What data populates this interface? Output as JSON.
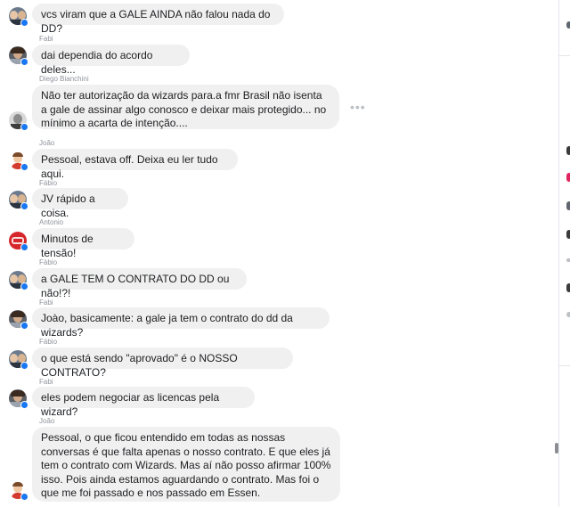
{
  "messages": [
    {
      "sender": "",
      "text": "vcs viram que a GALE AINDA não falou nada do DD?",
      "avatar": "group-avatar"
    },
    {
      "sender": "Fabi",
      "text": "dai dependia do acordo deles...",
      "avatar": "fabi-avatar"
    },
    {
      "sender": "Diego Bianchini",
      "text": "Não ter autorização da wizards para.a fmr Brasil não isenta a gale de assinar algo conosco e deixar mais protegido... no mínimo a acarta de intenção....",
      "avatar": "diego-avatar"
    },
    {
      "sender": "João",
      "text": "Pessoal, estava off. Deixa eu ler tudo aqui.",
      "avatar": "joao-avatar"
    },
    {
      "sender": "Fábio",
      "text": "JV rápido a coisa.",
      "avatar": "fabio-avatar"
    },
    {
      "sender": "Antonio",
      "text": "Minutos de tensão!",
      "avatar": "antonio-avatar"
    },
    {
      "sender": "Fábio",
      "text": "a GALE TEM O CONTRATO DO DD ou não!?!",
      "avatar": "fabio-avatar"
    },
    {
      "sender": "Fabi",
      "text": "Joào, basicamente: a gale ja tem o contrato do dd da wizards?",
      "avatar": "fabi-avatar"
    },
    {
      "sender": "Fábio",
      "text": "o que está sendo \"aprovado\" é o NOSSO CONTRATO?",
      "avatar": "fabio-avatar"
    },
    {
      "sender": "Fabi",
      "text": "eles podem negociar as licencas pela wizard?",
      "avatar": "fabi-avatar"
    },
    {
      "sender": "João",
      "text": "Pessoal, o que ficou entendido em todas as nossas conversas é que falta apenas o nosso contrato. E que eles já tem o contrato com Wizards. Mas aí não posso afirmar 100% isso. Pois ainda estamos aguardando o contrato. Mas foi o que me foi passado e nos passado em Essen.",
      "avatar": "joao-avatar"
    }
  ],
  "more_options": "•••",
  "colors": {
    "bubble": "#f1f0f0",
    "online": "#1877f2",
    "text": "#1c1e21",
    "sender": "#90949c"
  }
}
